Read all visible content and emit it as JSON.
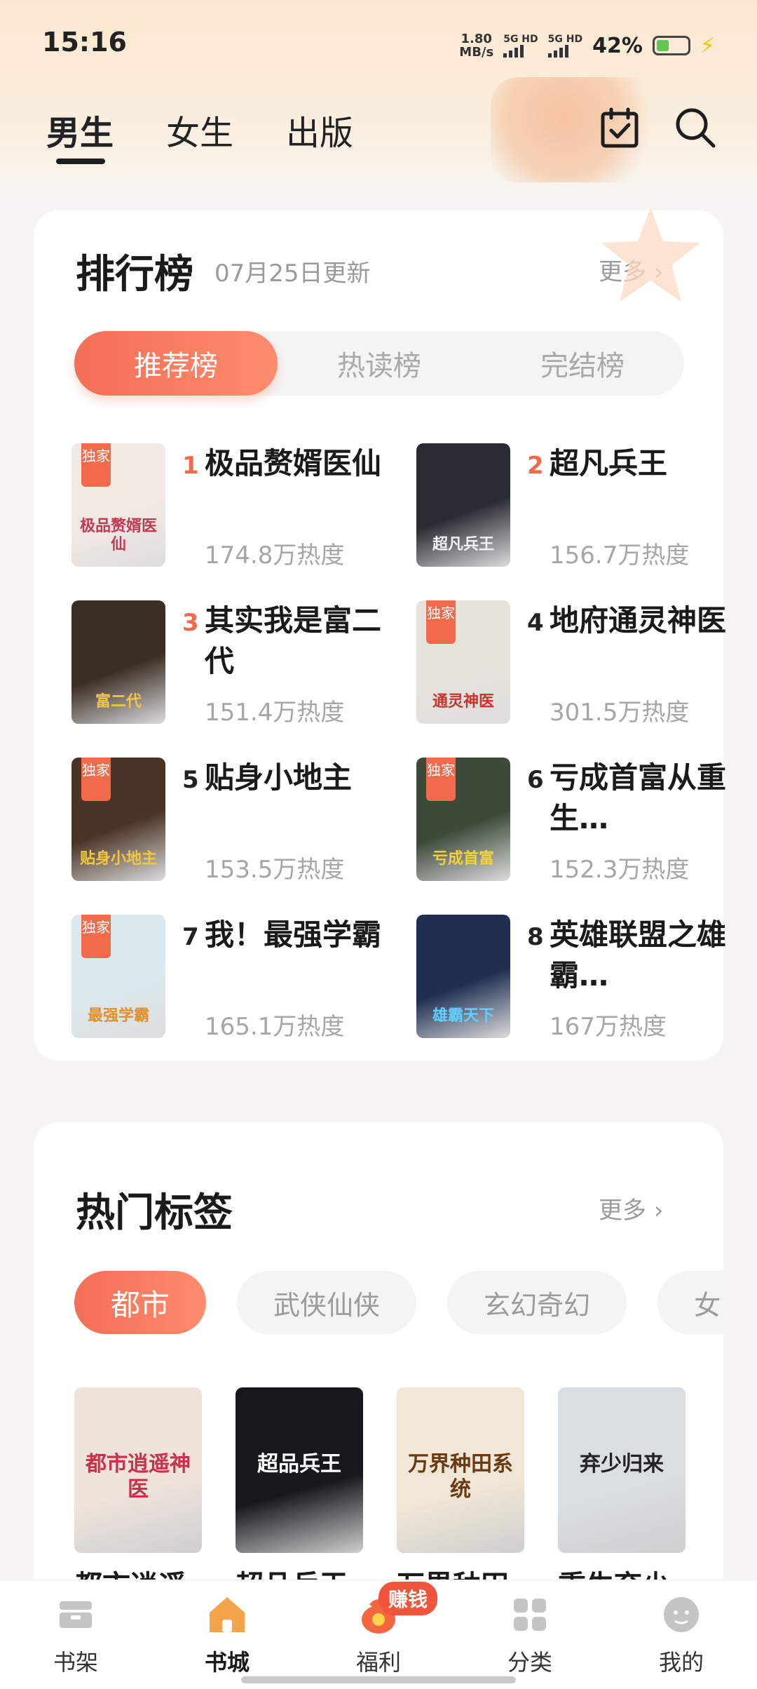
{
  "status_bar": {
    "time": "15:16",
    "net_speed_value": "1.80",
    "net_speed_unit": "MB/s",
    "signal_1": "5G HD",
    "signal_2": "5G HD",
    "battery_percent": "42%",
    "battery_level": 0.42
  },
  "header": {
    "tabs": [
      {
        "label": "男生",
        "active": true
      },
      {
        "label": "女生",
        "active": false
      },
      {
        "label": "出版",
        "active": false
      }
    ],
    "checkin_icon": "calendar-check-icon",
    "search_icon": "search-icon"
  },
  "ranking": {
    "title": "排行榜",
    "updated": "07月25日更新",
    "more": "更多",
    "segments": [
      {
        "label": "推荐榜",
        "active": true
      },
      {
        "label": "热读榜",
        "active": false
      },
      {
        "label": "完结榜",
        "active": false
      }
    ],
    "items": [
      {
        "rank": "1",
        "title": "极品赘婿医仙",
        "heat": "174.8万热度",
        "cover_title": "极品赘婿医仙",
        "exclusive": "独家"
      },
      {
        "rank": "2",
        "title": "超凡兵王",
        "heat": "156.7万热度",
        "cover_title": "超凡兵王",
        "exclusive": ""
      },
      {
        "rank": "3",
        "title": "其实我是富二代",
        "heat": "151.4万热度",
        "cover_title": "富二代",
        "exclusive": ""
      },
      {
        "rank": "4",
        "title": "地府通灵神医",
        "heat": "301.5万热度",
        "cover_title": "通灵神医",
        "exclusive": "独家"
      },
      {
        "rank": "5",
        "title": "贴身小地主",
        "heat": "153.5万热度",
        "cover_title": "贴身小地主",
        "exclusive": "独家"
      },
      {
        "rank": "6",
        "title": "亏成首富从重生…",
        "heat": "152.3万热度",
        "cover_title": "亏成首富",
        "exclusive": "独家"
      },
      {
        "rank": "7",
        "title": "我！最强学霸",
        "heat": "165.1万热度",
        "cover_title": "最强学霸",
        "exclusive": "独家"
      },
      {
        "rank": "8",
        "title": "英雄联盟之雄霸…",
        "heat": "167万热度",
        "cover_title": "雄霸天下",
        "exclusive": ""
      }
    ]
  },
  "hot_tags": {
    "title": "热门标签",
    "more": "更多",
    "tags": [
      {
        "label": "都市",
        "active": true
      },
      {
        "label": "武侠仙侠",
        "active": false
      },
      {
        "label": "玄幻奇幻",
        "active": false
      },
      {
        "label": "女",
        "active": false
      }
    ],
    "books": [
      {
        "name": "都市逍遥…",
        "cover_title": "都市逍遥神医"
      },
      {
        "name": "超品兵王",
        "cover_title": "超品兵王"
      },
      {
        "name": "万界种田…",
        "cover_title": "万界种田系统"
      },
      {
        "name": "重生弃少…",
        "cover_title": "弃少归来"
      }
    ]
  },
  "bottom_nav": {
    "items": [
      {
        "label": "书架",
        "icon": "bookshelf-icon",
        "active": false
      },
      {
        "label": "书城",
        "icon": "home-icon",
        "active": true
      },
      {
        "label": "福利",
        "icon": "money-bag-icon",
        "active": false
      },
      {
        "label": "分类",
        "icon": "category-grid-icon",
        "active": false
      },
      {
        "label": "我的",
        "icon": "profile-icon",
        "active": false
      }
    ],
    "badge": "赚钱"
  },
  "colors": {
    "accent": "#f36f55",
    "home_active": "#f5a44a"
  }
}
